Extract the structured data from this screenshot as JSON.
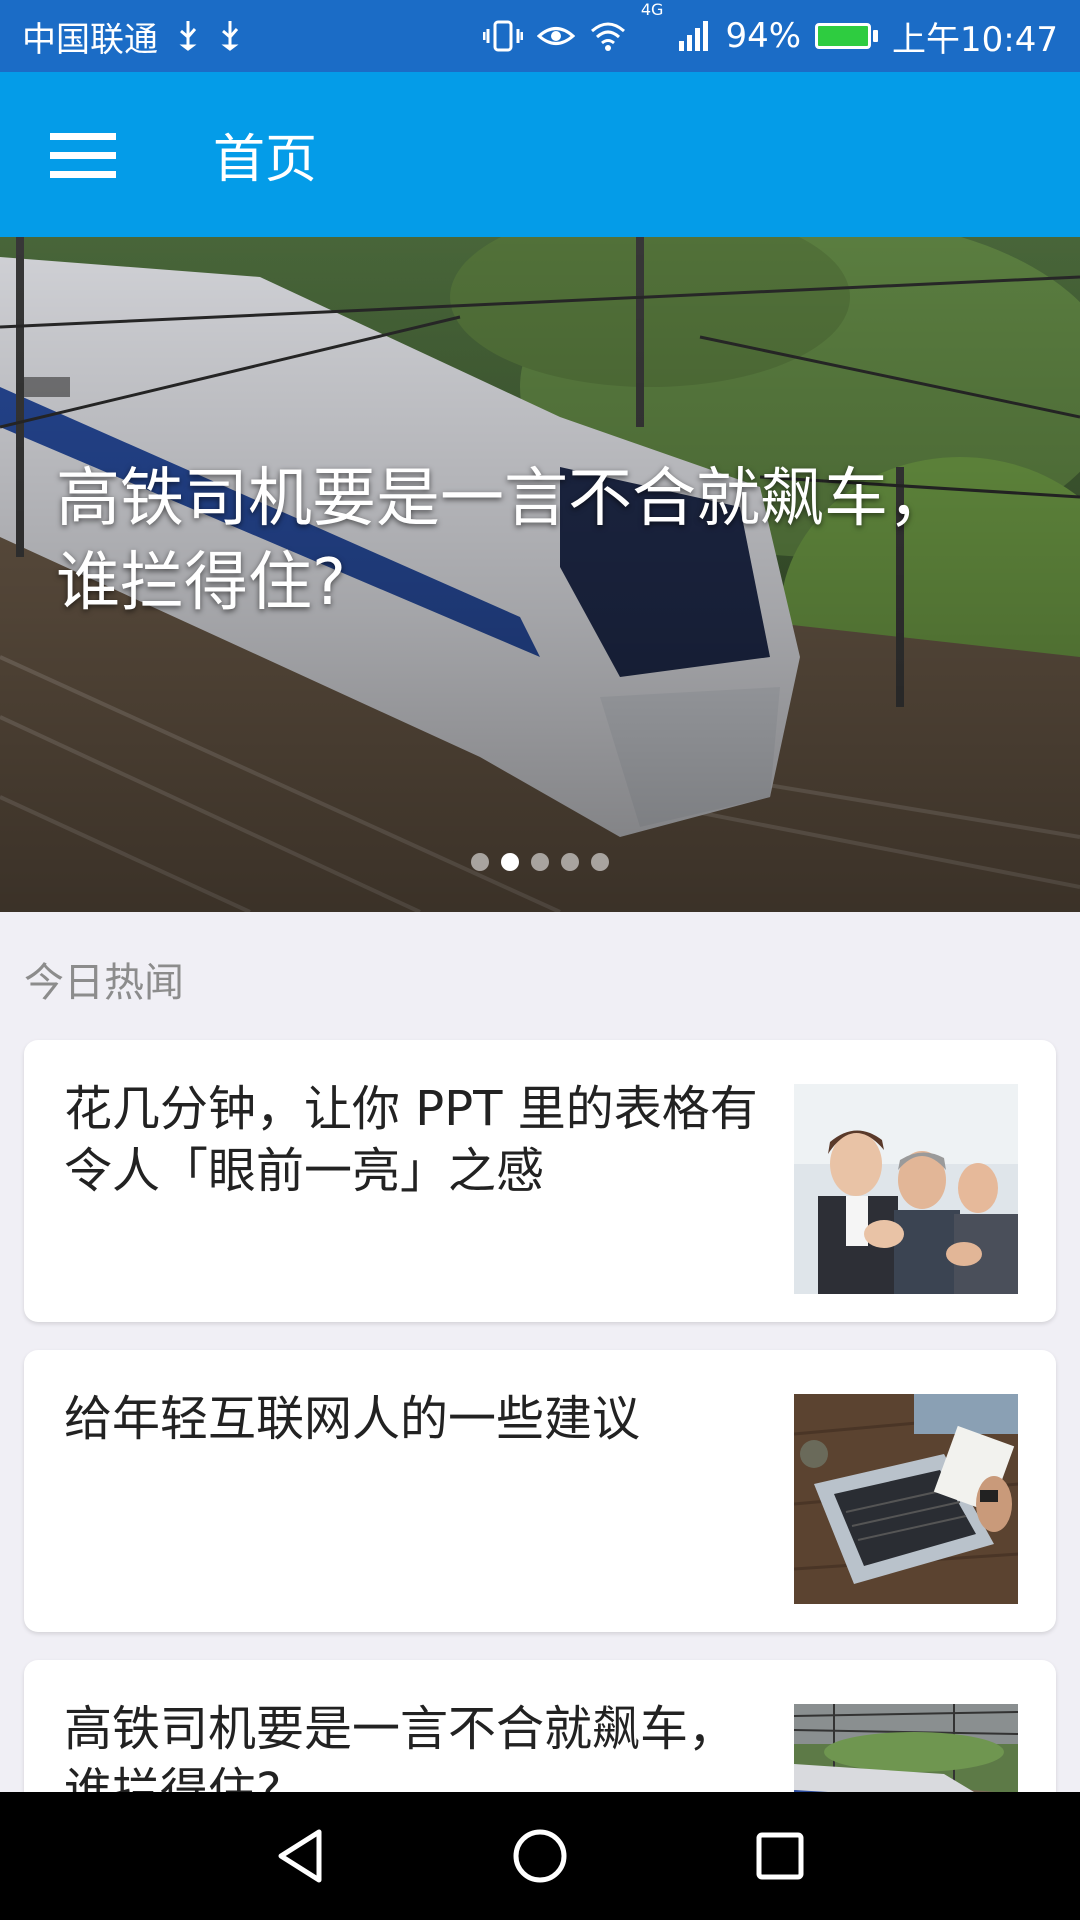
{
  "status_bar": {
    "carrier": "中国联通",
    "network": "4G",
    "battery": "94%",
    "time": "上午10:47"
  },
  "app_bar": {
    "title": "首页"
  },
  "banner": {
    "headline": "高铁司机要是一言不合就飙车，谁拦得住?",
    "slide_count": 5,
    "active_slide": 2
  },
  "section": {
    "title": "今日热闻"
  },
  "articles": [
    {
      "title": "花几分钟，让你 PPT 里的表格有令人「眼前一亮」之感",
      "thumb": "business-people-clapping"
    },
    {
      "title": "给年轻互联网人的一些建议",
      "thumb": "laptop-on-wooden-table"
    },
    {
      "title": "高铁司机要是一言不合就飙车，谁拦得住?",
      "thumb": "high-speed-train"
    }
  ],
  "colors": {
    "status_bar": "#1b6cc6",
    "app_bar": "#049ce8",
    "background": "#f0eff5"
  }
}
